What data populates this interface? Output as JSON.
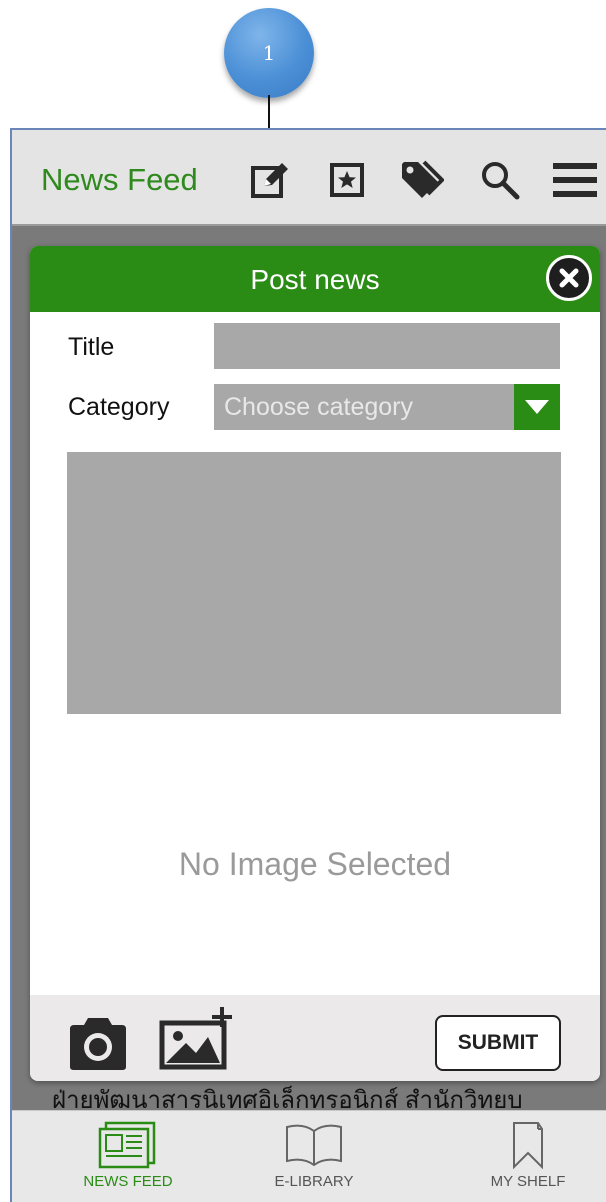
{
  "annotation": {
    "step_number": "1"
  },
  "navbar": {
    "title": "News Feed",
    "icons": [
      "compose-icon",
      "favorites-icon",
      "tag-icon",
      "search-icon",
      "menu-icon"
    ]
  },
  "modal": {
    "title": "Post news",
    "title_label": "Title",
    "title_value": "",
    "category_label": "Category",
    "category_placeholder": "Choose category",
    "no_image_text": "No Image Selected",
    "submit_label": "SUBMIT"
  },
  "background": {
    "news_text": "ฝ่ายพัฒนาสารนิเทศอิเล็กทรอนิกส์ สำนักวิทยบ"
  },
  "tabs": [
    {
      "label": "NEWS FEED",
      "active": true
    },
    {
      "label": "E-LIBRARY",
      "active": false
    },
    {
      "label": "MY SHELF",
      "active": false
    }
  ],
  "colors": {
    "brand_green": "#2a8c14",
    "annotation_blue": "#4b8fd6",
    "field_gray": "#a8a8a8"
  }
}
